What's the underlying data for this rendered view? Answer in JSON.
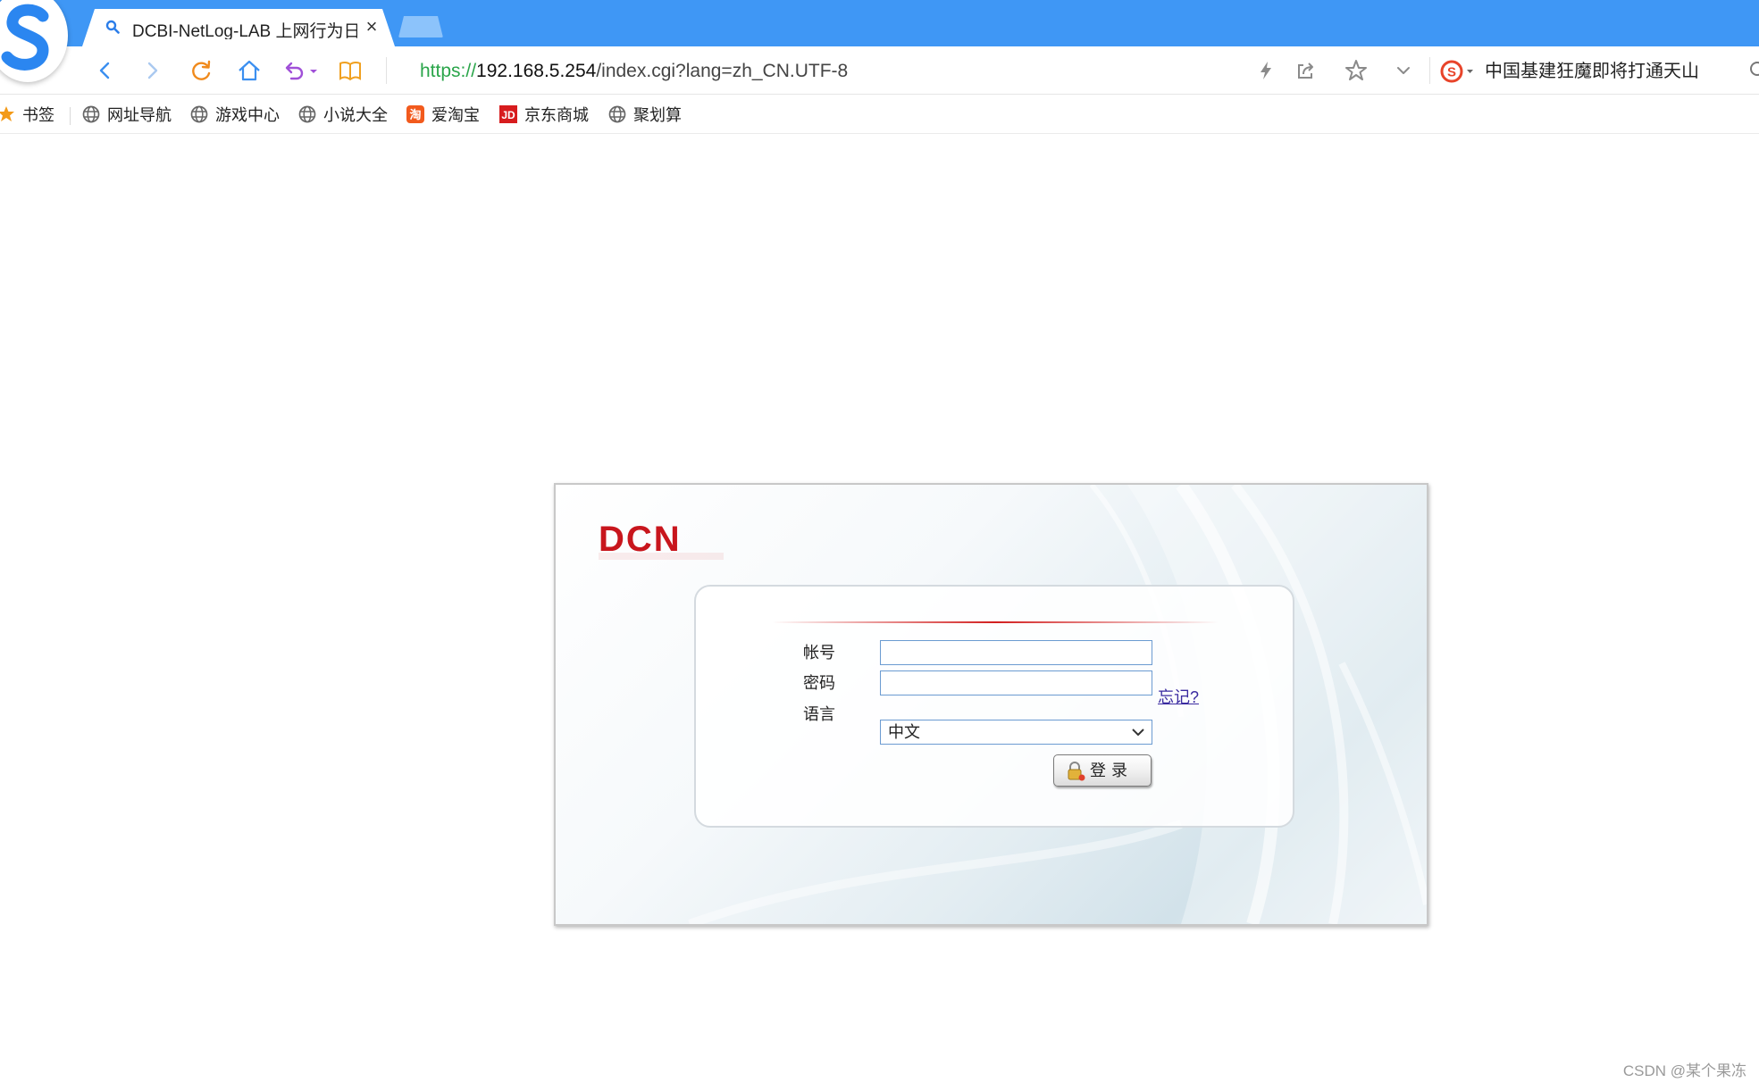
{
  "browser": {
    "tab": {
      "title": "DCBI-NetLog-LAB 上网行为日",
      "close": "×"
    },
    "address": {
      "scheme": "https://",
      "host": "192.168.5.254",
      "path": "/index.cgi?lang=zh_CN.UTF-8"
    },
    "search": {
      "text": "中国基建狂魔即将打通天山"
    },
    "bookmarks": [
      {
        "label": "书签",
        "icon": "star-icon"
      },
      {
        "label": "网址导航",
        "icon": "globe-icon"
      },
      {
        "label": "游戏中心",
        "icon": "globe-icon"
      },
      {
        "label": "小说大全",
        "icon": "globe-icon"
      },
      {
        "label": "爱淘宝",
        "icon": "taobao-icon"
      },
      {
        "label": "京东商城",
        "icon": "jd-icon"
      },
      {
        "label": "聚划算",
        "icon": "globe-icon"
      }
    ],
    "colors": {
      "tabbar": "#3f97f5",
      "scheme_green": "#2aa54a"
    }
  },
  "login": {
    "brand": "DCN",
    "account_label": "帐号",
    "password_label": "密码",
    "forgot": "忘记?",
    "language_label": "语言",
    "language_value": "中文",
    "submit_label": "登录",
    "brand_color": "#c8161d"
  },
  "watermark": "CSDN @某个果冻"
}
